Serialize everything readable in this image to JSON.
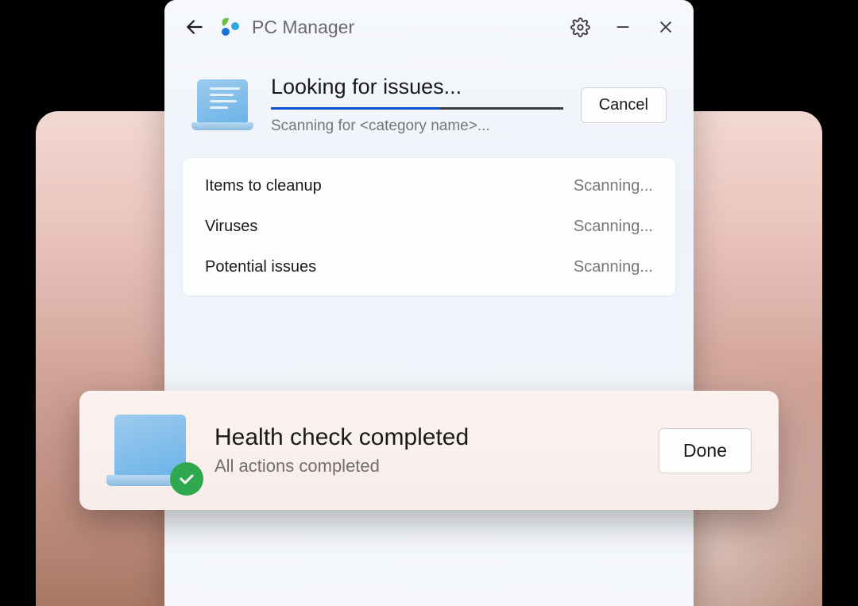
{
  "header": {
    "app_title": "PC Manager"
  },
  "scan": {
    "title": "Looking for issues...",
    "subtitle": "Scanning for <category name>...",
    "cancel_label": "Cancel",
    "progress_percent": 58
  },
  "results": {
    "rows": [
      {
        "label": "Items to cleanup",
        "status": "Scanning..."
      },
      {
        "label": "Viruses",
        "status": "Scanning..."
      },
      {
        "label": "Potential issues",
        "status": "Scanning..."
      }
    ]
  },
  "toast": {
    "title": "Health check completed",
    "subtitle": "All actions completed",
    "done_label": "Done"
  },
  "colors": {
    "accent": "#0a53d6",
    "success": "#2fa84f"
  }
}
